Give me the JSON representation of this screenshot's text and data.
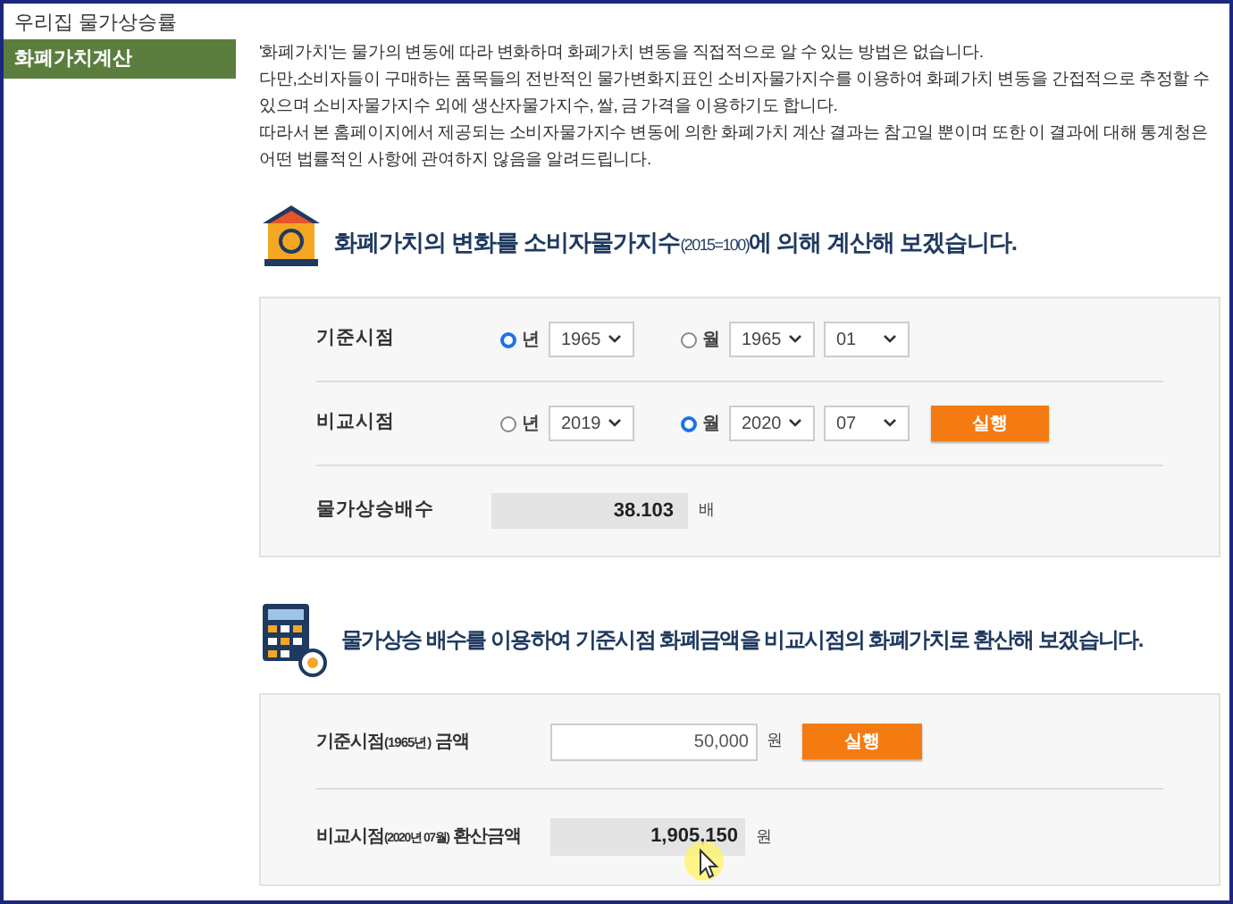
{
  "sidebar": {
    "items": [
      {
        "label": "우리집 물가상승률",
        "selected": false
      },
      {
        "label": "화폐가치계산",
        "selected": true
      }
    ]
  },
  "intro": {
    "paragraphs": [
      "'화폐가치'는 물가의 변동에 따라 변화하며 화폐가치 변동을 직접적으로 알 수 있는 방법은 없습니다.",
      "다만,소비자들이 구매하는 품목들의 전반적인 물가변화지표인 소비자물가지수를 이용하여 화폐가치 변동을 간접적으로 추정할 수 있으며 소비자물가지수 외에 생산자물가지수, 쌀, 금 가격을 이용하기도 합니다.",
      "따라서 본 홈페이지에서 제공되는 소비자물가지수 변동에 의한 화폐가치 계산 결과는 참고일 뿐이며 또한 이 결과에 대해 통계청은 어떤 법률적인 사항에 관여하지 않음을 알려드립니다."
    ]
  },
  "index_section": {
    "title": {
      "main": "화폐가치의 변화를 소비자물가지수",
      "note": "(2015=100)",
      "tail": "에 의해 계산해 보겠습니다."
    },
    "rows": [
      {
        "label": "기준시점",
        "year_option": {
          "label": "년",
          "selected": true,
          "year": "1965"
        },
        "month_option": {
          "label": "월",
          "selected": false,
          "year": "1965",
          "month": "01"
        }
      },
      {
        "label": "비교시점",
        "year_option": {
          "label": "년",
          "selected": false,
          "year": "2019"
        },
        "month_option": {
          "label": "월",
          "selected": true,
          "year": "2020",
          "month": "07"
        },
        "button": "실행"
      }
    ],
    "multiplier": {
      "label": "물가상승배수",
      "value": "38.103",
      "unit": "배"
    }
  },
  "conversion_section": {
    "title": "물가상승 배수를 이용하여 기준시점 화폐금액을 비교시점의 화폐가치로 환산해 보겠습니다.",
    "amount": {
      "label": "기준시점",
      "note": "(1965년)",
      "tail": " 금액",
      "value": "50,000",
      "unit": "원",
      "button": "실행"
    },
    "result": {
      "label": "비교시점",
      "note": "(2020년 07월)",
      "tail": " 환산금액",
      "value": "1,905,150",
      "unit": "원"
    }
  }
}
